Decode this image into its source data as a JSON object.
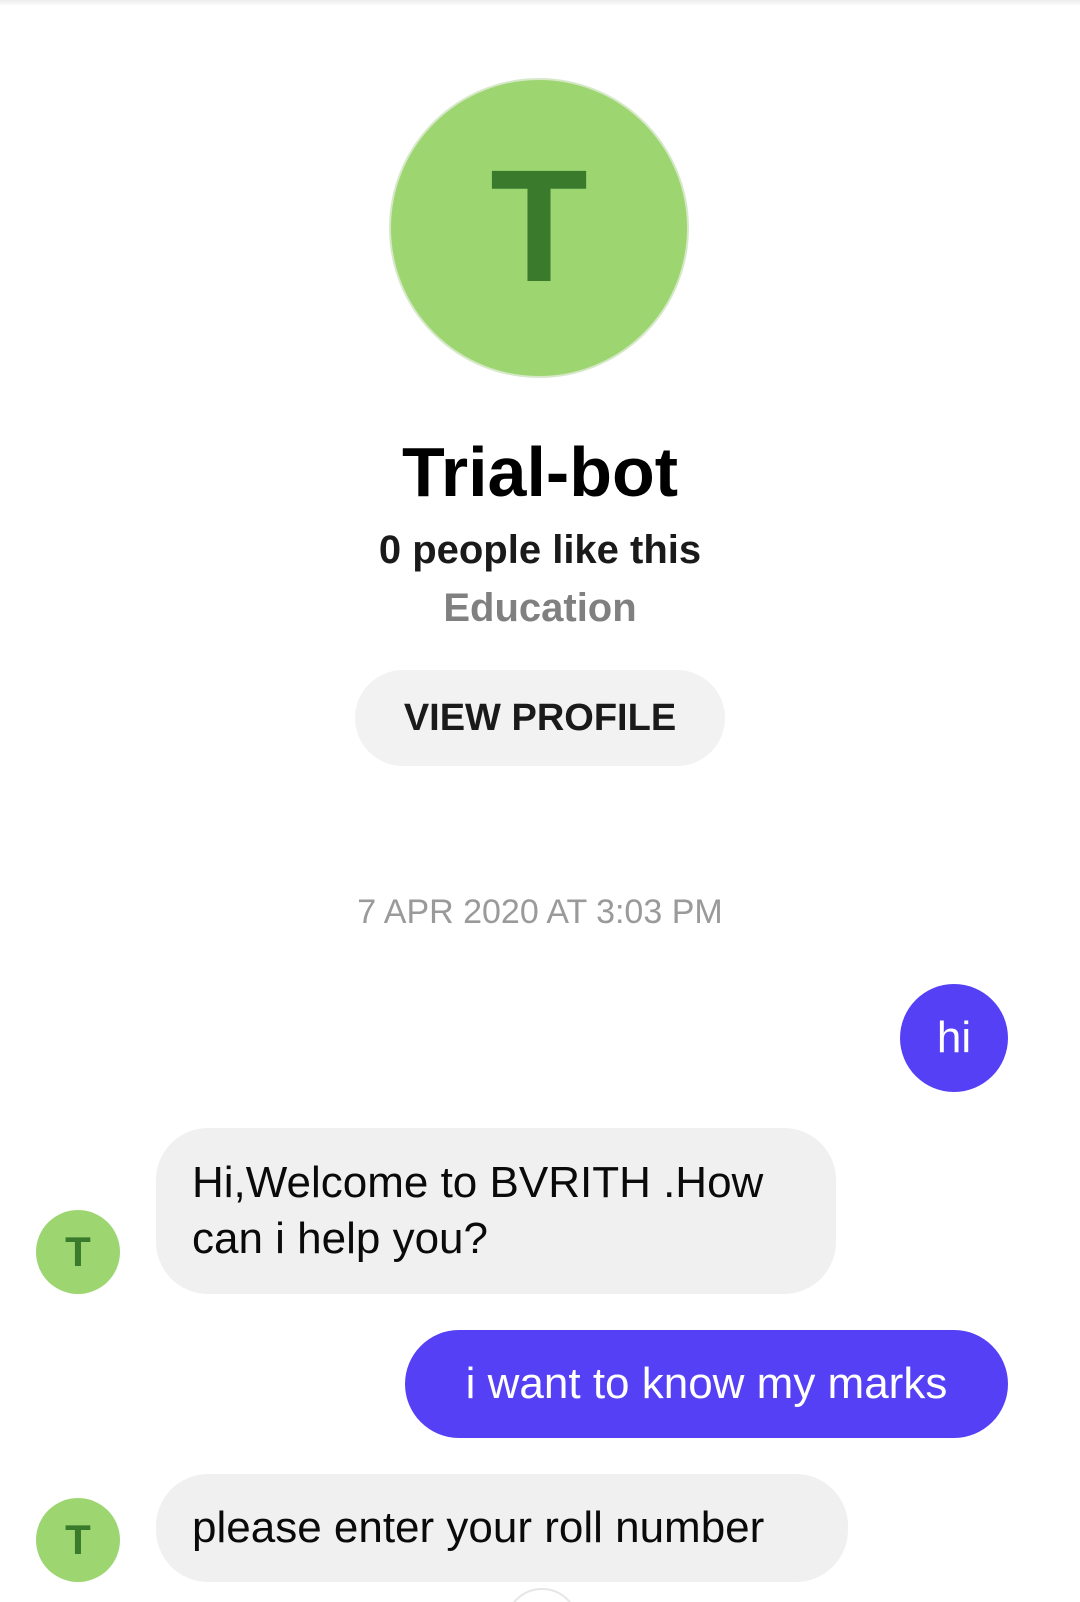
{
  "profile": {
    "avatar_letter": "T",
    "name": "Trial-bot",
    "likes": "0 people like this",
    "category": "Education",
    "view_profile_label": "VIEW PROFILE"
  },
  "conversation": {
    "timestamp": "7 APR 2020 AT 3:03 PM",
    "messages": [
      {
        "sender": "user",
        "text": "hi"
      },
      {
        "sender": "bot",
        "avatar_letter": "T",
        "text": "Hi,Welcome to BVRITH .How can i help you?"
      },
      {
        "sender": "user",
        "text": "i want to know my marks"
      },
      {
        "sender": "bot",
        "avatar_letter": "T",
        "text": "please enter your roll number"
      }
    ]
  },
  "colors": {
    "avatar_bg": "#9dd670",
    "avatar_letter": "#3a7a2d",
    "outgoing_bubble": "#5640f5",
    "incoming_bubble": "#f0f0f0"
  }
}
